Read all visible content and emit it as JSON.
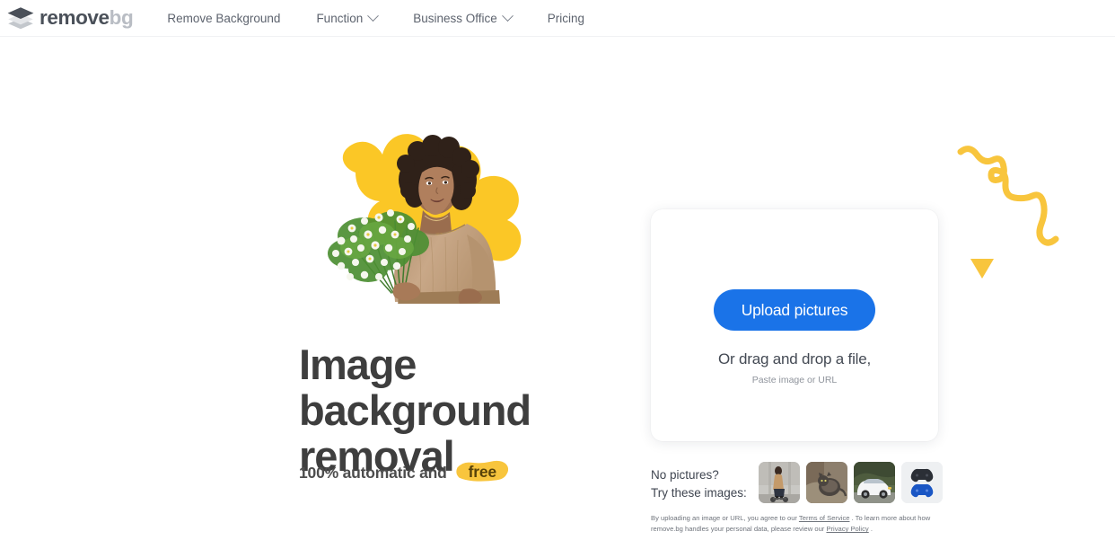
{
  "header": {
    "logo": {
      "icon": "layers-icon",
      "text_primary": "remove",
      "text_secondary": "bg"
    },
    "nav": [
      {
        "label": "Remove Background",
        "has_chevron": false
      },
      {
        "label": "Function",
        "has_chevron": true
      },
      {
        "label": "Business Office",
        "has_chevron": true
      },
      {
        "label": "Pricing",
        "has_chevron": false
      }
    ]
  },
  "hero": {
    "image_alt": "woman-with-flowers-photo",
    "blob_color": "#fbc726",
    "headline_line1": "Image",
    "headline_line2": "background",
    "headline_line3": "removal",
    "subline_text": "100% automatic and",
    "subline_highlight": "free",
    "highlight_color": "#f8c53d"
  },
  "upload_card": {
    "button_label": "Upload pictures",
    "button_color": "#1a73e8",
    "drag_text": "Or drag and drop a file,",
    "paste_text": "Paste image or URL"
  },
  "samples": {
    "label_line1": "No pictures?",
    "label_line2": "Try these images:",
    "thumbnails": [
      {
        "name": "sample-person-scooter"
      },
      {
        "name": "sample-cat"
      },
      {
        "name": "sample-white-car"
      },
      {
        "name": "sample-game-controllers"
      }
    ]
  },
  "legal": {
    "part1": "By uploading an image or URL, you agree to our ",
    "link1": "Terms of Service",
    "part2": " . To learn more about how remove.bg handles your personal data, please review our ",
    "link2": "Privacy Policy",
    "part3": " ."
  },
  "decor": {
    "squiggle_color": "#f8c53d",
    "triangle_color": "#f8c53d"
  }
}
